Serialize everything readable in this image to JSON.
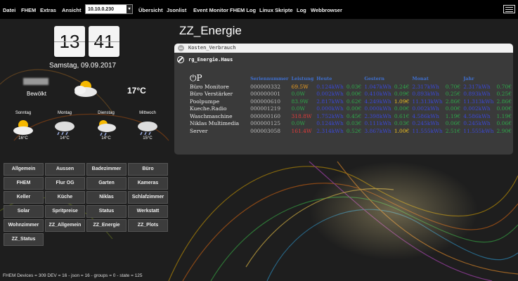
{
  "menu": {
    "items": [
      "Datei",
      "FHEM",
      "Extras",
      "Ansicht",
      "Übersicht",
      "Jsonlist",
      "Event Monitor",
      "FHEM Log",
      "Linux Skripte",
      "Log",
      "Webbrowser"
    ],
    "host_select": "10.10.0.230"
  },
  "clock": {
    "hours": "13",
    "minutes": "41",
    "date": "Samstag, 09.09.2017"
  },
  "weather": {
    "condition": "Bewölkt",
    "temperature": "17°C",
    "forecast": [
      {
        "day": "Sonntag",
        "temp": "16°C",
        "icon": "partly-cloudy-icon"
      },
      {
        "day": "Montag",
        "temp": "14°C",
        "icon": "rain-cloud-icon"
      },
      {
        "day": "Dienstag",
        "temp": "14°C",
        "icon": "sun-rain-icon"
      },
      {
        "day": "Mittwoch",
        "temp": "15°C",
        "icon": "rain-cloud-icon"
      }
    ]
  },
  "rooms": [
    "Allgemein",
    "Aussen",
    "Badezimmer",
    "Büro",
    "FHEM",
    "Flur OG",
    "Garten",
    "Kameras",
    "Keller",
    "Küche",
    "Niklas",
    "Schlafzimmer",
    "Solar",
    "Spritpreise",
    "Status",
    "Werkstatt",
    "Wohnzimmer",
    "ZZ_Allgemein",
    "ZZ_Energie",
    "ZZ_Plots",
    "ZZ_Status"
  ],
  "page_title": "ZZ_Energie",
  "panel": {
    "group_name": "Kosten_Verbrauch",
    "device_name": "rg_Energie.Haus",
    "columns": [
      "Seriennummer",
      "Leistung",
      "Heute",
      "",
      "Gestern",
      "",
      "Monat",
      "",
      "Jahr",
      ""
    ],
    "rows": [
      {
        "name": "Büro Monitore",
        "serial": "000000332",
        "power": "69.5W",
        "power_color": "orange",
        "today": "0.124kWh",
        "today_c": "0.03€",
        "yest": "1.047kWh",
        "yest_c": "0.24€",
        "month": "2.317kWh",
        "month_c": "0.70€",
        "year": "2.317kWh",
        "year_c": "0.70€"
      },
      {
        "name": "Büro Verstärker",
        "serial": "000000001",
        "power": "0.0W",
        "power_color": "green",
        "today": "0.002kWh",
        "today_c": "0.00€",
        "yest": "0.410kWh",
        "yest_c": "0.09€",
        "month": "0.893kWh",
        "month_c": "0.25€",
        "year": "0.893kWh",
        "year_c": "0.25€"
      },
      {
        "name": "Poolpumpe",
        "serial": "000000610",
        "power": "83.9W",
        "power_color": "green",
        "today": "2.817kWh",
        "today_c": "0.62€",
        "yest": "4.249kWh",
        "yest_c": "1.09€",
        "yest_c_color": "gold",
        "month": "11.313kWh",
        "month_c": "2.86€",
        "year": "11.313kWh",
        "year_c": "2.86€"
      },
      {
        "name": "Kueche.Radio",
        "serial": "000001219",
        "power": "0.0W",
        "power_color": "green",
        "today": "0.000kWh",
        "today_c": "0.00€",
        "yest": "0.000kWh",
        "yest_c": "0.00€",
        "month": "0.002kWh",
        "month_c": "0.00€",
        "year": "0.002kWh",
        "year_c": "0.00€"
      },
      {
        "name": "Waschmaschine",
        "serial": "000000160",
        "power": "318.8W",
        "power_color": "red",
        "today": "1.752kWh",
        "today_c": "0.45€",
        "yest": "2.398kWh",
        "yest_c": "0.61€",
        "month": "4.586kWh",
        "month_c": "1.19€",
        "year": "4.586kWh",
        "year_c": "1.19€"
      },
      {
        "name": "Niklas Multimedia",
        "serial": "000000125",
        "power": "0.0W",
        "power_color": "green",
        "today": "0.124kWh",
        "today_c": "0.03€",
        "yest": "0.111kWh",
        "yest_c": "0.03€",
        "month": "0.245kWh",
        "month_c": "0.06€",
        "year": "0.245kWh",
        "year_c": "0.06€"
      },
      {
        "name": "Server",
        "serial": "000003058",
        "power": "161.4W",
        "power_color": "red",
        "today": "2.314kWh",
        "today_c": "0.52€",
        "yest": "3.867kWh",
        "yest_c": "1.00€",
        "yest_c_color": "gold",
        "month": "11.555kWh",
        "month_c": "2.51€",
        "year": "11.555kWh",
        "year_c": "2.90€"
      }
    ]
  },
  "footer": "FHEM Devices = 309  DEV = 16 - json = 16 - groups = 0 - state = 125"
}
